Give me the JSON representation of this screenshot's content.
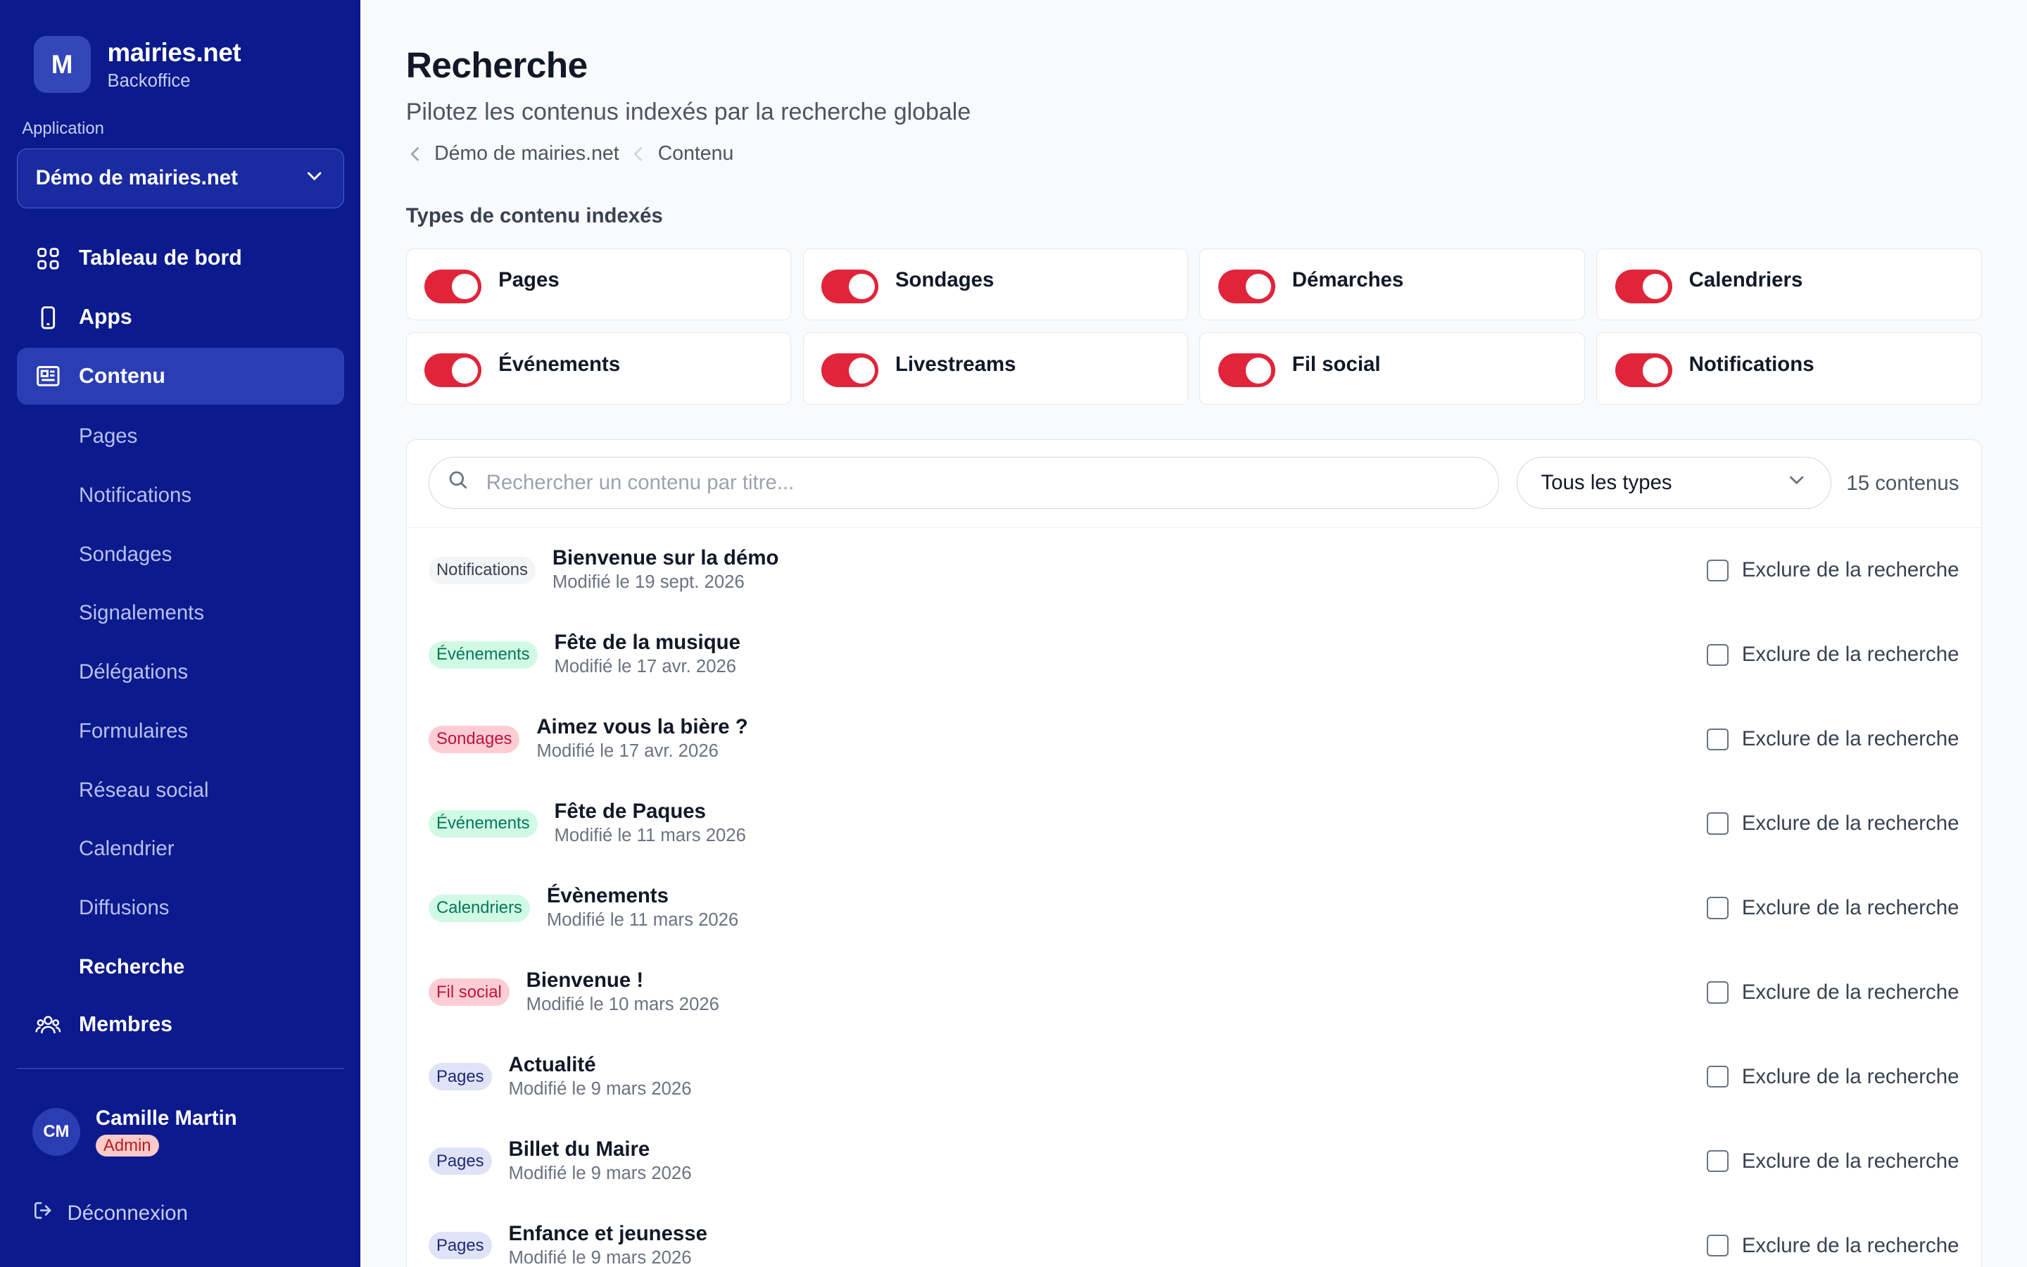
{
  "brand": {
    "logo_letter": "M",
    "name": "mairies.net",
    "subtitle": "Backoffice"
  },
  "app_switcher": {
    "label": "Application",
    "selected": "Démo de mairies.net"
  },
  "nav": {
    "dashboard": "Tableau de bord",
    "apps": "Apps",
    "content": "Contenu",
    "content_sub": [
      "Pages",
      "Notifications",
      "Sondages",
      "Signalements",
      "Délégations",
      "Formulaires",
      "Réseau social",
      "Calendrier",
      "Diffusions",
      "Recherche"
    ],
    "members": "Membres"
  },
  "user": {
    "initials": "CM",
    "name": "Camille Martin",
    "role": "Admin"
  },
  "logout_label": "Déconnexion",
  "page": {
    "title": "Recherche",
    "subtitle": "Pilotez les contenus indexés par la recherche globale",
    "breadcrumb": [
      "Démo de mairies.net",
      "Contenu"
    ],
    "types_title": "Types de contenu indexés"
  },
  "content_types": [
    {
      "label": "Pages",
      "enabled": true
    },
    {
      "label": "Sondages",
      "enabled": true
    },
    {
      "label": "Démarches",
      "enabled": true
    },
    {
      "label": "Calendriers",
      "enabled": true
    },
    {
      "label": "Événements",
      "enabled": true
    },
    {
      "label": "Livestreams",
      "enabled": true
    },
    {
      "label": "Fil social",
      "enabled": true
    },
    {
      "label": "Notifications",
      "enabled": true
    }
  ],
  "list": {
    "search_placeholder": "Rechercher un contenu par titre...",
    "type_filter": "Tous les types",
    "count": "15 contenus",
    "exclude_label": "Exclure de la recherche",
    "items": [
      {
        "tag": "Notifications",
        "title": "Bienvenue sur la démo",
        "date": "Modifié le 19 sept. 2026"
      },
      {
        "tag": "Événements",
        "title": "Fête de la musique",
        "date": "Modifié le 17 avr. 2026"
      },
      {
        "tag": "Sondages",
        "title": "Aimez vous la bière ?",
        "date": "Modifié le 17 avr. 2026"
      },
      {
        "tag": "Événements",
        "title": "Fête de Paques",
        "date": "Modifié le 11 mars 2026"
      },
      {
        "tag": "Calendriers",
        "title": "Évènements",
        "date": "Modifié le 11 mars 2026"
      },
      {
        "tag": "Fil social",
        "title": "Bienvenue !",
        "date": "Modifié le 10 mars 2026"
      },
      {
        "tag": "Pages",
        "title": "Actualité",
        "date": "Modifié le 9 mars 2026"
      },
      {
        "tag": "Pages",
        "title": "Billet du Maire",
        "date": "Modifié le 9 mars 2026"
      },
      {
        "tag": "Pages",
        "title": "Enfance et jeunesse",
        "date": "Modifié le 9 mars 2026"
      }
    ]
  },
  "tag_colors": {
    "Notifications": {
      "bg": "#f3f4f6",
      "fg": "#374151"
    },
    "Événements": {
      "bg": "#d1fae5",
      "fg": "#047857"
    },
    "Sondages": {
      "bg": "#fecdd3",
      "fg": "#be123c"
    },
    "Calendriers": {
      "bg": "#d1fae5",
      "fg": "#047857"
    },
    "Fil social": {
      "bg": "#fecdd3",
      "fg": "#be123c"
    },
    "Pages": {
      "bg": "#e0e3f7",
      "fg": "#1e2a78"
    }
  },
  "colors": {
    "sidebar": "#0b1a8c",
    "toggle_on": "#e0243a",
    "active_nav": "#2a3db3"
  }
}
